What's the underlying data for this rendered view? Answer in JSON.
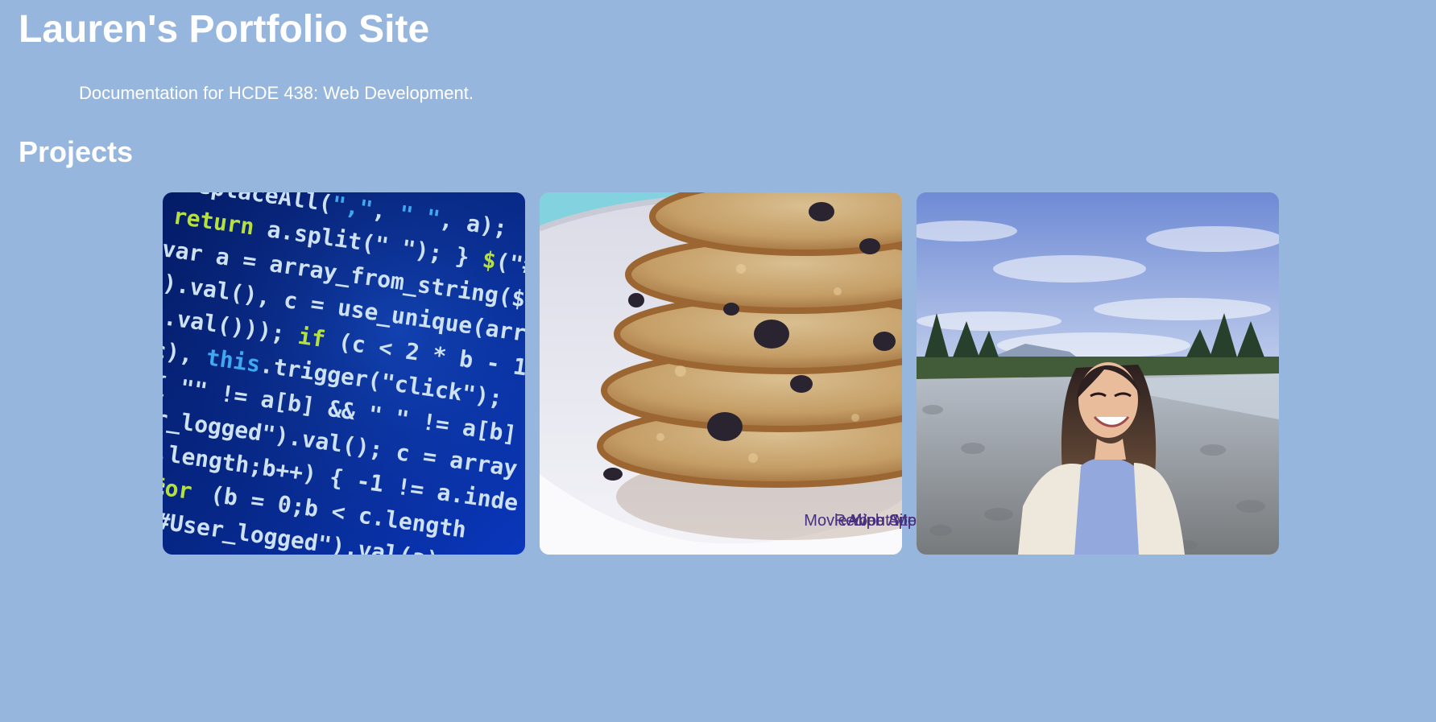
{
  "site": {
    "title": "Lauren's Portfolio Site",
    "tagline": "Documentation for HCDE 438: Web Development."
  },
  "projects": {
    "heading": "Projects",
    "cards": [
      {
        "image": "code-screenshot-image",
        "label": "Movie Web App"
      },
      {
        "image": "oatmeal-raisin-cookies-image",
        "label": "Recipe Site"
      },
      {
        "image": "lauren-riverbank-portrait-image",
        "label": "About Me"
      }
    ]
  },
  "colors": {
    "background": "#97b6dd",
    "text": "#ffffff",
    "link": "#4a2f7f"
  }
}
